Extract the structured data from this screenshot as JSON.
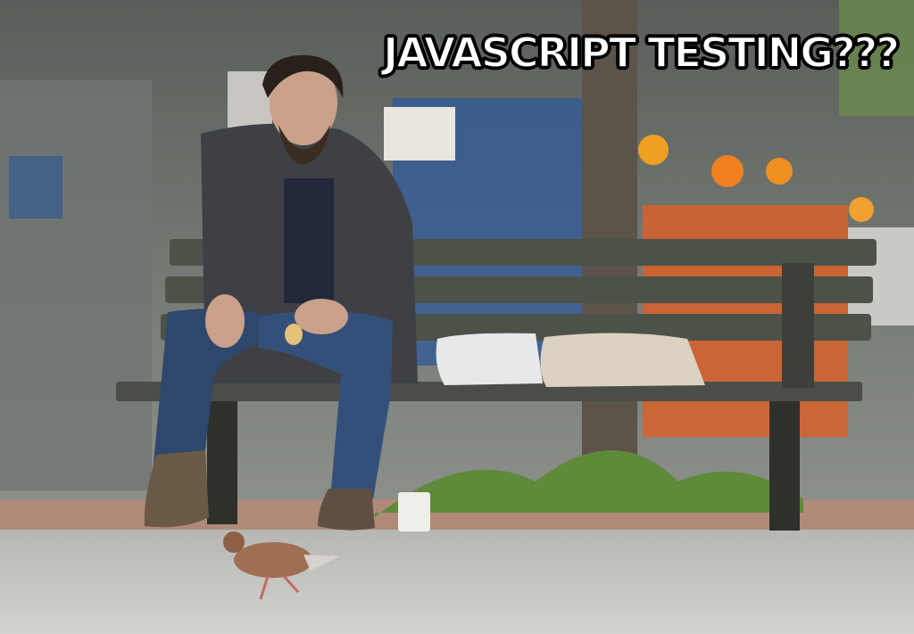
{
  "meme": {
    "caption": "JAVASCRIPT TESTING???"
  }
}
